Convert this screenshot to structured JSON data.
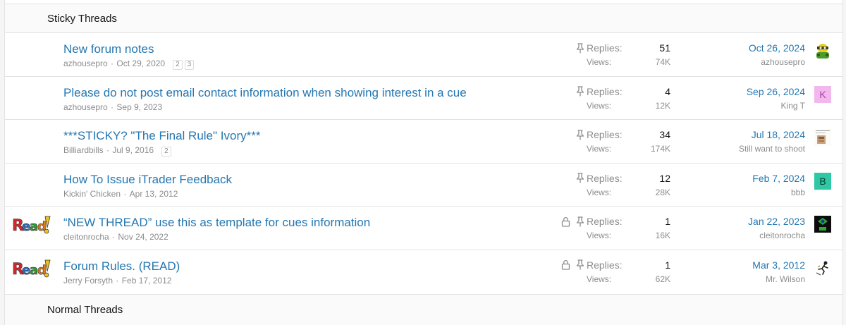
{
  "sections": {
    "sticky": "Sticky Threads",
    "normal": "Normal Threads"
  },
  "labels": {
    "replies": "Replies:",
    "views": "Views:"
  },
  "threads": [
    {
      "title": "New forum notes",
      "starter": "azhousepro",
      "date": "Oct 29, 2020",
      "pages": [
        "2",
        "3"
      ],
      "locked": false,
      "read_icon": false,
      "replies": "51",
      "views": "74K",
      "last_date": "Oct 26, 2024",
      "last_user": "azhousepro",
      "avatar": {
        "type": "image",
        "icon": "green-character-avatar"
      }
    },
    {
      "title": "Please do not post email contact information when showing interest in a cue",
      "starter": "azhousepro",
      "date": "Sep 9, 2023",
      "pages": [],
      "locked": false,
      "read_icon": false,
      "replies": "4",
      "views": "12K",
      "last_date": "Sep 26, 2024",
      "last_user": "King T",
      "avatar": {
        "type": "letter",
        "letter": "K",
        "bg": "#f0b8ec",
        "fg": "#b23aa8"
      }
    },
    {
      "title": "***STICKY? \"The Final Rule\" Ivory***",
      "starter": "Billiardbills",
      "date": "Jul 9, 2016",
      "pages": [
        "2"
      ],
      "locked": false,
      "read_icon": false,
      "replies": "34",
      "views": "174K",
      "last_date": "Jul 18, 2024",
      "last_user": "Still want to shoot",
      "avatar": {
        "type": "image",
        "icon": "document-avatar"
      }
    },
    {
      "title": "How To Issue iTrader Feedback",
      "starter": "Kickin' Chicken",
      "date": "Apr 13, 2012",
      "pages": [],
      "locked": false,
      "read_icon": false,
      "replies": "12",
      "views": "28K",
      "last_date": "Feb 7, 2024",
      "last_user": "bbb",
      "avatar": {
        "type": "letter",
        "letter": "B",
        "bg": "#2ec8a4",
        "fg": "#0e3a30"
      }
    },
    {
      "title": "“NEW THREAD” use this as template for cues information",
      "starter": "cleitonrocha",
      "date": "Nov 24, 2022",
      "pages": [],
      "locked": true,
      "read_icon": true,
      "replies": "1",
      "views": "16K",
      "last_date": "Jan 22, 2023",
      "last_user": "cleitonrocha",
      "avatar": {
        "type": "image",
        "icon": "dark-green-avatar"
      }
    },
    {
      "title": "Forum Rules. (READ)",
      "starter": "Jerry Forsyth",
      "date": "Feb 17, 2012",
      "pages": [],
      "locked": true,
      "read_icon": true,
      "replies": "1",
      "views": "62K",
      "last_date": "Mar 3, 2012",
      "last_user": "Mr. Wilson",
      "avatar": {
        "type": "image",
        "icon": "skater-avatar"
      }
    }
  ],
  "read_icon_text": "Read!",
  "colors": {
    "link": "#2577b1",
    "muted": "#8c8c8c",
    "border": "#e3e3e3"
  }
}
